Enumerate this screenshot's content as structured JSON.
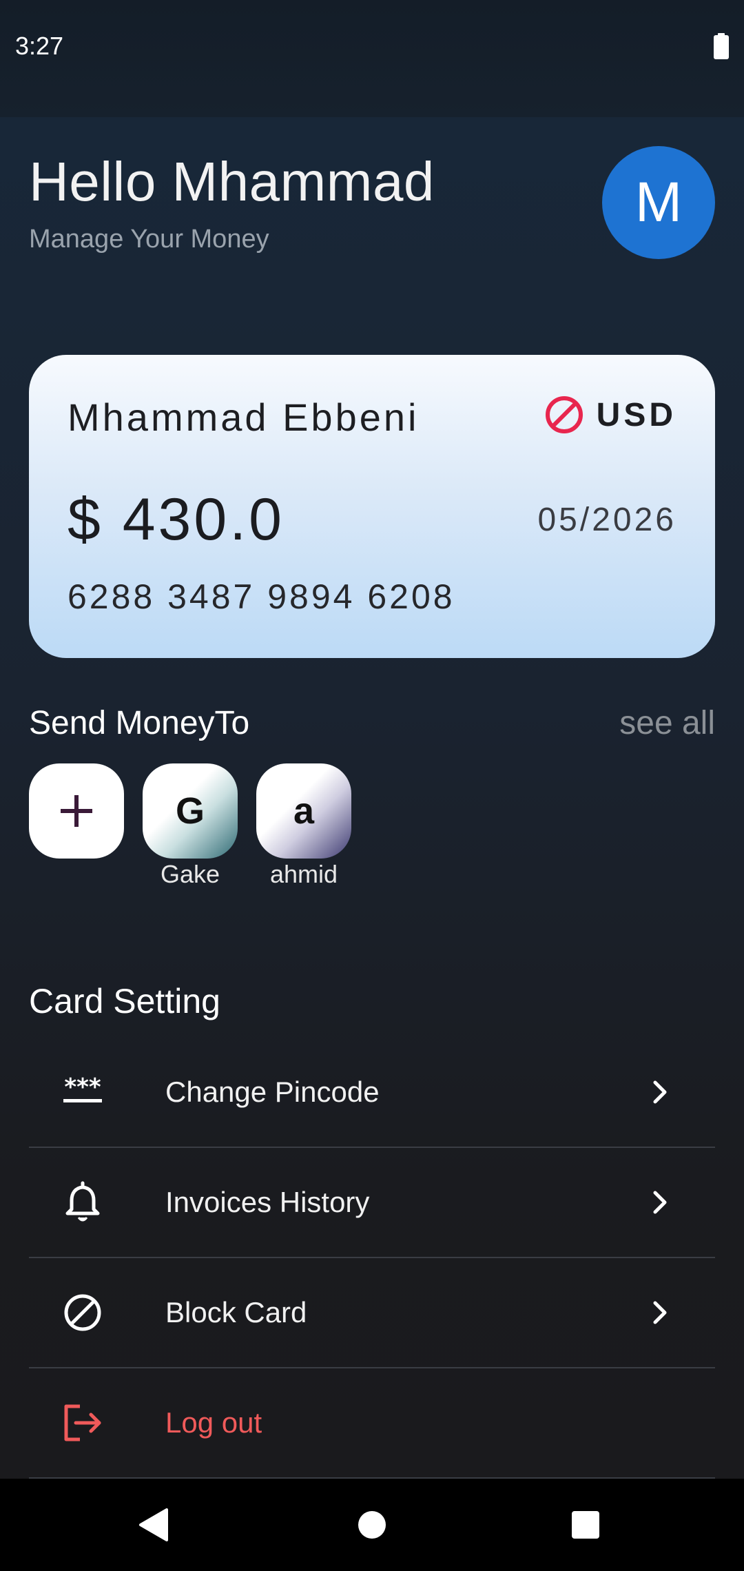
{
  "status_bar": {
    "time": "3:27"
  },
  "header": {
    "greeting": "Hello Mhammad",
    "subtitle": "Manage Your Money",
    "avatar_letter": "M",
    "avatar_color": "#1e73d2"
  },
  "card": {
    "holder_name": "Mhammad Ebbeni",
    "currency": "USD",
    "balance": "$ 430.0",
    "expiry": "05/2026",
    "number": "6288 3487 9894 6208",
    "block_icon": "block-icon",
    "accent_color": "#e8264e"
  },
  "send_money": {
    "title": "Send MoneyTo",
    "see_all": "see all",
    "add_icon": "plus-icon",
    "contacts": [
      {
        "initial": "G",
        "name": "Gake"
      },
      {
        "initial": "a",
        "name": "ahmid"
      }
    ]
  },
  "card_settings": {
    "title": "Card Setting",
    "items": [
      {
        "label": "Change Pincode",
        "icon": "pincode-icon"
      },
      {
        "label": "Invoices History",
        "icon": "bell-icon"
      },
      {
        "label": "Block Card",
        "icon": "block-icon"
      },
      {
        "label": "Log out",
        "icon": "logout-icon",
        "color": "#f05a5a"
      }
    ]
  }
}
